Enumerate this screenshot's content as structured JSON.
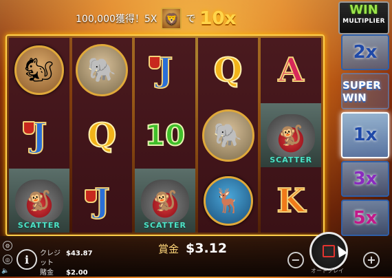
{
  "banner": {
    "prefix": "100,000獲得！5X",
    "mid": "で",
    "multiplier": "10x",
    "icon": "lion-icon"
  },
  "logo": {
    "win": "WIN",
    "multiplier": "MULTIPLIER"
  },
  "reels": [
    [
      "meerkat",
      "J",
      "baboon-scatter"
    ],
    [
      "elephant",
      "Q",
      "J"
    ],
    [
      "J",
      "10",
      "baboon-scatter"
    ],
    [
      "Q",
      "elephant",
      "antelope"
    ],
    [
      "A",
      "baboon-scatter",
      "K"
    ]
  ],
  "scatter_label": "SCATTER",
  "multipliers": {
    "items": [
      "2x",
      "SUPER WIN",
      "1x",
      "3x",
      "5x"
    ],
    "active": "1x"
  },
  "bottom": {
    "credit_label": "クレジット",
    "credit_value": "$43.87",
    "bet_label": "賭金",
    "bet_value": "$2.00",
    "win_label": "賞金",
    "win_value": "$3.12",
    "autoplay_label": "オートプレイ"
  },
  "colors": {
    "frame": "#ffcf4a",
    "reel_bg": "#3a1116",
    "multiplier_blue": "#1f49a8"
  }
}
